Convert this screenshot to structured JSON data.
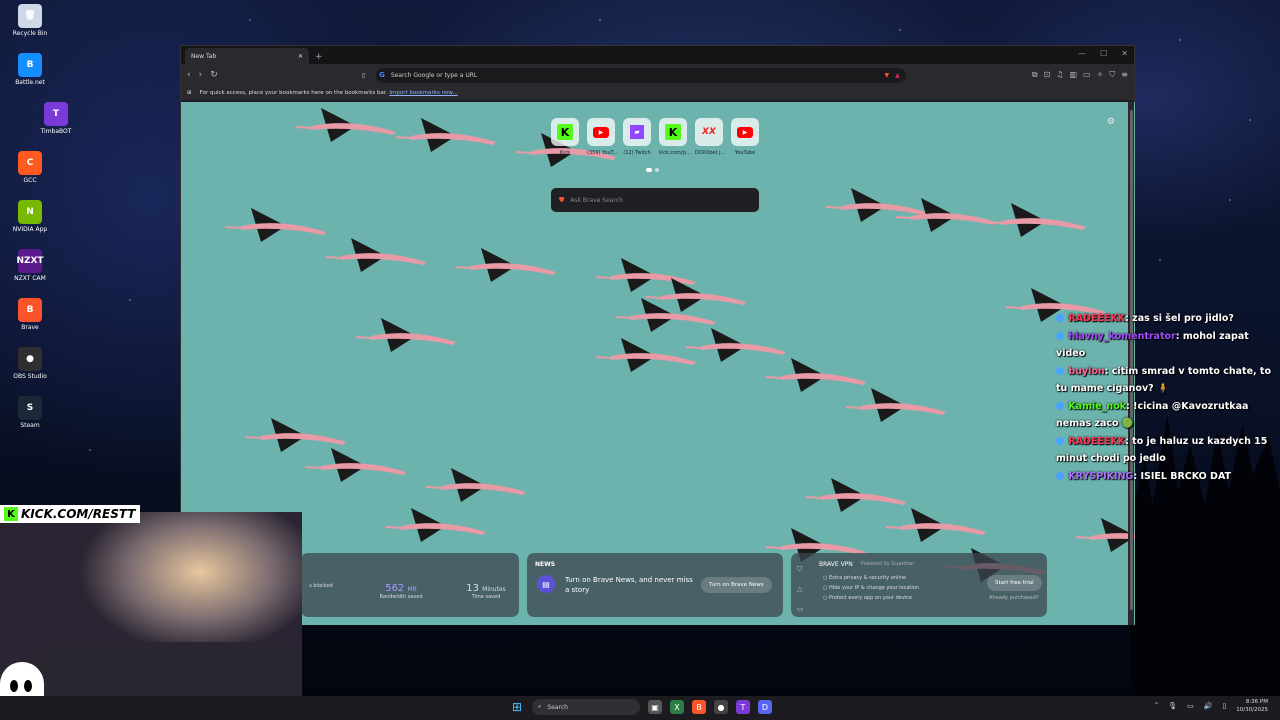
{
  "desktop": {
    "icons": [
      {
        "label": "Recycle Bin",
        "glyph": "🗑",
        "color": "#cfd8e6"
      },
      {
        "label": "Battle.net",
        "glyph": "B",
        "color": "#148eff"
      },
      {
        "label": "TimbaBOT",
        "glyph": "T",
        "color": "#7a3ad8"
      },
      {
        "label": "GCC",
        "glyph": "C",
        "color": "#ff5a1f"
      },
      {
        "label": "NVIDIA App",
        "glyph": "N",
        "color": "#76b900"
      },
      {
        "label": "NZXT CAM",
        "glyph": "NZXT",
        "color": "#5a1a8c"
      },
      {
        "label": "Brave",
        "glyph": "B",
        "color": "#fb542b"
      },
      {
        "label": "OBS Studio",
        "glyph": "●",
        "color": "#302e31"
      },
      {
        "label": "Steam",
        "glyph": "S",
        "color": "#1b2838"
      }
    ]
  },
  "browser": {
    "tab_title": "New Tab",
    "new_tab": "+",
    "address_placeholder": "Search Google or type a URL",
    "bookmarks_prompt": "For quick access, place your bookmarks here on the bookmarks bar.",
    "import_link": "Import bookmarks now...",
    "tiles": [
      {
        "label": "Kick",
        "type": "k"
      },
      {
        "label": "(359) YouT...",
        "type": "y"
      },
      {
        "label": "(12) Twitch",
        "type": "t"
      },
      {
        "label": "kick.com/p...",
        "type": "k"
      },
      {
        "label": "DOXXbet j...",
        "type": "x"
      },
      {
        "label": "YouTube",
        "type": "y"
      }
    ],
    "search_placeholder": "Ask Brave Search",
    "stats": {
      "blocked_label": "s blocked",
      "bandwidth_value": "562",
      "bandwidth_unit": "MB",
      "bandwidth_label": "Bandwidth saved",
      "time_value": "13",
      "time_unit": "Minutes",
      "time_label": "Time saved"
    },
    "news": {
      "heading": "NEWS",
      "text": "Turn on Brave News, and never miss a story",
      "button": "Turn on Brave News"
    },
    "vpn": {
      "heading": "BRAVE VPN",
      "powered": "Powered by Guardian",
      "features": [
        "Extra privacy & security online",
        "Hide your IP & change your location",
        "Protect every app on your device"
      ],
      "button": "Start free trial",
      "link": "Already purchased?"
    }
  },
  "chat": [
    {
      "user": "RADEEEKK",
      "color": "#ff3a5a",
      "text": ": zas si šel pro jidlo?"
    },
    {
      "user": "hlavny_komentrator",
      "color": "#a54aff",
      "text": ": mohol zapat video"
    },
    {
      "user": "buylon",
      "color": "#ff6a9a",
      "text": ": citim smrad v tomto chate, to tu mame ciganov? 🧍"
    },
    {
      "user": "Kamie_nok",
      "color": "#53fc18",
      "text": ": !cicina @Kavozrutkaa nemas zaco 🟢"
    },
    {
      "user": "RADEEEKK",
      "color": "#ff3a5a",
      "text": ": to je haluz uz kazdych 15 minut chodi po jedlo"
    },
    {
      "user": "KRYSPIKING",
      "color": "#b070ff",
      "text": ": ISIEL BRCKO DAT"
    }
  ],
  "overlay": {
    "kick_handle": "KICK.COM/RESTT"
  },
  "taskbar": {
    "search": "Search",
    "time": "8:36 PM",
    "date": "10/30/2025"
  }
}
